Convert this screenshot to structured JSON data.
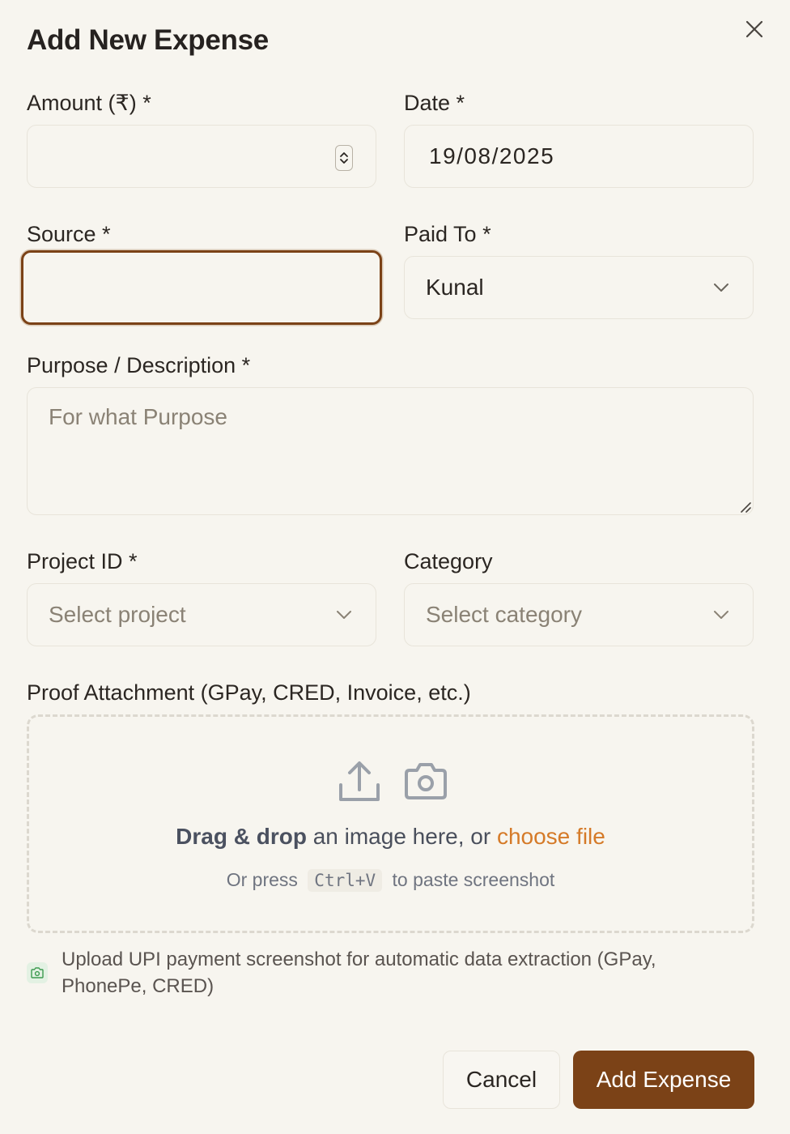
{
  "dialog": {
    "title": "Add New Expense",
    "close_icon": "close-icon"
  },
  "form": {
    "amount": {
      "label": "Amount (₹) *",
      "value": ""
    },
    "date": {
      "label": "Date *",
      "value": "19/08/2025"
    },
    "source": {
      "label": "Source *",
      "value": ""
    },
    "paid_to": {
      "label": "Paid To *",
      "value": "Kunal"
    },
    "purpose": {
      "label": "Purpose / Description *",
      "placeholder": "For what Purpose"
    },
    "project_id": {
      "label": "Project ID *",
      "placeholder": "Select project"
    },
    "category": {
      "label": "Category",
      "placeholder": "Select category"
    }
  },
  "attachment": {
    "label": "Proof Attachment (GPay, CRED, Invoice, etc.)",
    "drag_bold": "Drag & drop",
    "drag_text": " an image here, or ",
    "choose_file": "choose file",
    "paste_prefix": "Or press",
    "paste_key": "Ctrl+V",
    "paste_suffix": "to paste screenshot",
    "icons": [
      "upload-icon",
      "camera-icon"
    ],
    "hint": "Upload UPI payment screenshot for automatic data extraction (GPay, PhonePe, CRED)"
  },
  "actions": {
    "cancel_label": "Cancel",
    "submit_label": "Add Expense"
  },
  "colors": {
    "accent": "#7b4217",
    "link": "#d57a28",
    "background": "#f7f5ef"
  }
}
